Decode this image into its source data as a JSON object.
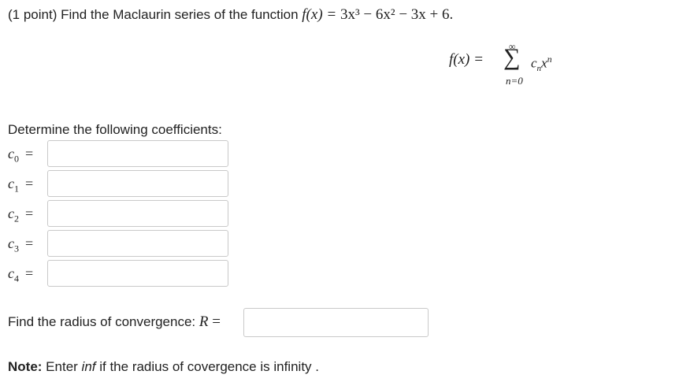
{
  "problem": {
    "points_label": "(1 point)",
    "text": "Find the Maclaurin series of the function",
    "function_lhs": "f(x) = ",
    "function_rhs": "3x³ − 6x² − 3x + 6."
  },
  "series": {
    "lhs": "f(x) = ",
    "sum_symbol": "∑",
    "upper": "∞",
    "lower": "n=0",
    "coef": "c",
    "coef_sub": "n",
    "var": "x",
    "var_sup": "n"
  },
  "instructions": "Determine the following coefficients:",
  "coefficients": [
    {
      "letter": "c",
      "index": "0",
      "eq": "=",
      "value": ""
    },
    {
      "letter": "c",
      "index": "1",
      "eq": "=",
      "value": ""
    },
    {
      "letter": "c",
      "index": "2",
      "eq": "=",
      "value": ""
    },
    {
      "letter": "c",
      "index": "3",
      "eq": "=",
      "value": ""
    },
    {
      "letter": "c",
      "index": "4",
      "eq": "=",
      "value": ""
    }
  ],
  "radius": {
    "text": "Find the radius of convergence:",
    "var": "R",
    "eq": "=",
    "value": ""
  },
  "note": {
    "bold": "Note:",
    "before": " Enter ",
    "italic": "inf",
    "after": " if the radius of covergence is infinity ."
  }
}
